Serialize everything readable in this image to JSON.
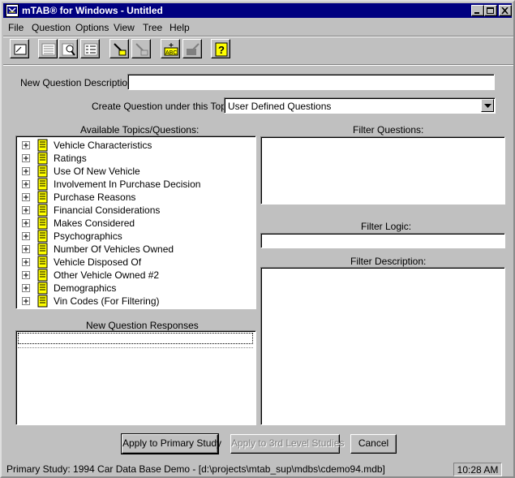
{
  "window": {
    "title": "mTAB® for Windows - Untitled"
  },
  "menu": {
    "file": "File",
    "question": "Question",
    "options": "Options",
    "view": "View",
    "tree": "Tree",
    "help": "Help"
  },
  "toolbar": {
    "icons": [
      "new-document-icon",
      "table-list-icon",
      "find-icon",
      "list-view-icon",
      "highlight-icon",
      "highlight-disabled-icon",
      "abc-edit-icon",
      "export-icon",
      "help-icon"
    ]
  },
  "form": {
    "description_label": "New Question Description:",
    "description_value": "",
    "topic_label": "Create Question under this Topic:",
    "topic_value": "User Defined Questions"
  },
  "topics": {
    "label": "Available Topics/Questions:",
    "items": [
      "Vehicle Characteristics",
      "Ratings",
      "Use Of New Vehicle",
      "Involvement In Purchase Decision",
      "Purchase Reasons",
      "Financial Considerations",
      "Makes Considered",
      "Psychographics",
      "Number Of Vehicles Owned",
      "Vehicle Disposed Of",
      "Other Vehicle Owned #2",
      "Demographics",
      "Vin Codes (For Filtering)"
    ]
  },
  "responses": {
    "label": "New Question Responses"
  },
  "filter": {
    "questions_label": "Filter Questions:",
    "logic_label": "Filter Logic:",
    "logic_value": "",
    "description_label": "Filter Description:"
  },
  "buttons": {
    "apply_primary": "Apply to Primary Study",
    "apply_third": "Apply to 3rd Level Studies",
    "cancel": "Cancel"
  },
  "status": {
    "study": "Primary Study: 1994 Car Data Base Demo - [d:\\projects\\mtab_sup\\mdbs\\cdemo94.mdb]",
    "time": "10:28 AM"
  }
}
